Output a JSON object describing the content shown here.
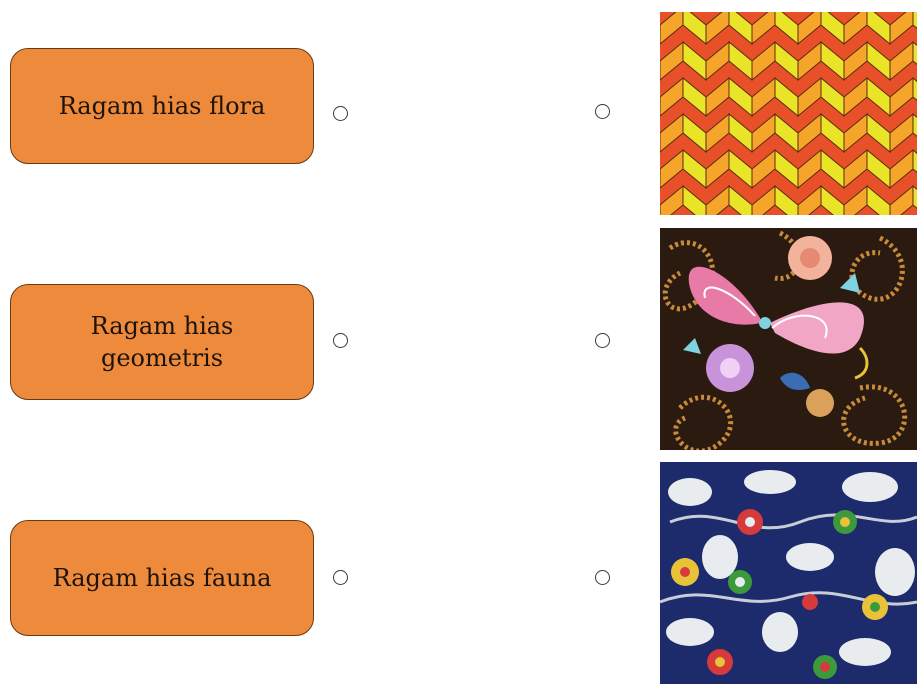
{
  "labels": [
    {
      "text": "Ragam hias flora"
    },
    {
      "text": "Ragam hias geometris"
    },
    {
      "text": "Ragam hias fauna"
    }
  ],
  "images": [
    {
      "icon": "chevron-geometric-pattern-image",
      "colors": [
        "#e8502a",
        "#f5a52a",
        "#e9e428"
      ]
    },
    {
      "icon": "butterfly-batik-pattern-image",
      "colors": [
        "#2a1a10",
        "#c78b3a",
        "#e87aa8",
        "#7fd3e0"
      ]
    },
    {
      "icon": "floral-batik-pattern-image",
      "colors": [
        "#1d2a6b",
        "#e9ecef",
        "#d63a3a",
        "#e8c33a",
        "#3c9a3c"
      ]
    }
  ],
  "colors": {
    "box_fill": "#ee8a3c",
    "box_border": "#6b3a12"
  }
}
